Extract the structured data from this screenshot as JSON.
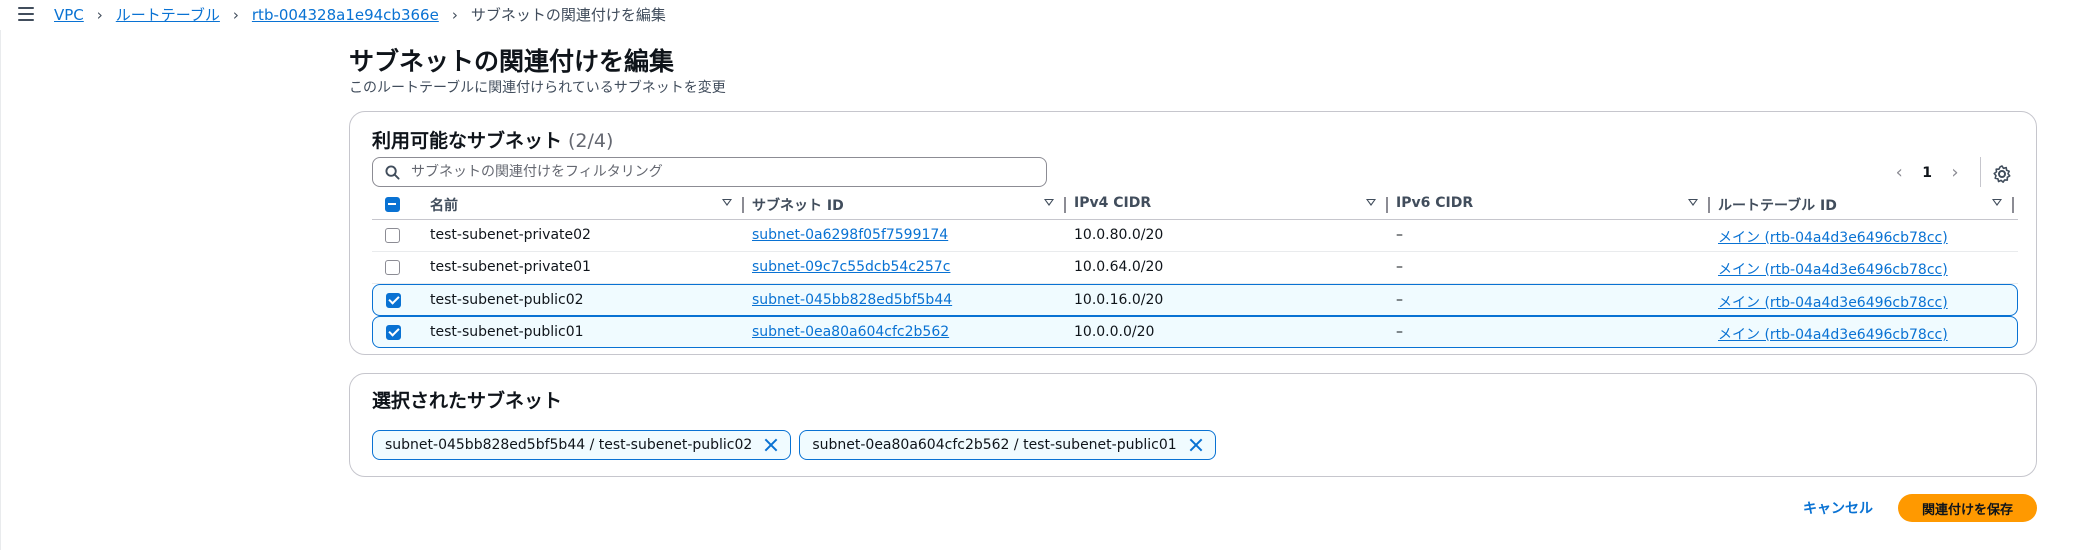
{
  "breadcrumb": {
    "items": [
      "VPC",
      "ルートテーブル",
      "rtb-004328a1e94cb366e"
    ],
    "current": "サブネットの関連付けを編集"
  },
  "header": {
    "title": "サブネットの関連付けを編集",
    "description": "このルートテーブルに関連付けられているサブネットを変更"
  },
  "available": {
    "title": "利用可能なサブネット",
    "count": "(2/4)",
    "filter_placeholder": "サブネットの関連付けをフィルタリング",
    "page": "1",
    "columns": [
      "名前",
      "サブネット ID",
      "IPv4 CIDR",
      "IPv6 CIDR",
      "ルートテーブル ID"
    ],
    "rows": [
      {
        "name": "test-subenet-private02",
        "subnet_id": "subnet-0a6298f05f7599174",
        "ipv4": "10.0.80.0/20",
        "ipv6": "–",
        "route_table": "メイン (rtb-04a4d3e6496cb78cc)",
        "selected": false
      },
      {
        "name": "test-subenet-private01",
        "subnet_id": "subnet-09c7c55dcb54c257c",
        "ipv4": "10.0.64.0/20",
        "ipv6": "–",
        "route_table": "メイン (rtb-04a4d3e6496cb78cc)",
        "selected": false
      },
      {
        "name": "test-subenet-public02",
        "subnet_id": "subnet-045bb828ed5bf5b44",
        "ipv4": "10.0.16.0/20",
        "ipv6": "–",
        "route_table": "メイン (rtb-04a4d3e6496cb78cc)",
        "selected": true
      },
      {
        "name": "test-subenet-public01",
        "subnet_id": "subnet-0ea80a604cfc2b562",
        "ipv4": "10.0.0.0/20",
        "ipv6": "–",
        "route_table": "メイン (rtb-04a4d3e6496cb78cc)",
        "selected": true
      }
    ]
  },
  "selected": {
    "title": "選択されたサブネット",
    "tokens": [
      "subnet-045bb828ed5bf5b44 / test-subenet-public02",
      "subnet-0ea80a604cfc2b562 / test-subenet-public01"
    ]
  },
  "actions": {
    "cancel": "キャンセル",
    "save": "関連付けを保存"
  },
  "colors": {
    "link": "#0972d3",
    "primary_button": "#ff9900",
    "selected_row_bg": "#f0fbff"
  }
}
